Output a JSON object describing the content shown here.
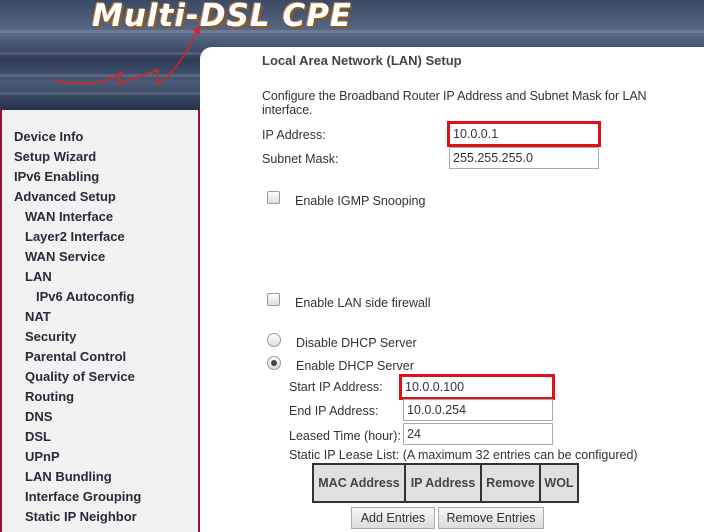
{
  "banner": {
    "logo_text": "Multi-DSL CPE"
  },
  "sidebar": {
    "items": [
      {
        "label": "Device Info",
        "level": 0
      },
      {
        "label": "Setup Wizard",
        "level": 0
      },
      {
        "label": "IPv6 Enabling",
        "level": 0
      },
      {
        "label": "Advanced Setup",
        "level": 0
      },
      {
        "label": "WAN Interface",
        "level": 1
      },
      {
        "label": "Layer2 Interface",
        "level": 1
      },
      {
        "label": "WAN Service",
        "level": 1
      },
      {
        "label": "LAN",
        "level": 1
      },
      {
        "label": "IPv6 Autoconfig",
        "level": 2
      },
      {
        "label": "NAT",
        "level": 1
      },
      {
        "label": "Security",
        "level": 1
      },
      {
        "label": "Parental Control",
        "level": 1
      },
      {
        "label": "Quality of Service",
        "level": 1
      },
      {
        "label": "Routing",
        "level": 1
      },
      {
        "label": "DNS",
        "level": 1
      },
      {
        "label": "DSL",
        "level": 1
      },
      {
        "label": "UPnP",
        "level": 1
      },
      {
        "label": "LAN Bundling",
        "level": 1
      },
      {
        "label": "Interface Grouping",
        "level": 1
      },
      {
        "label": "Static IP Neighbor",
        "level": 1
      }
    ]
  },
  "main": {
    "title": "Local Area Network (LAN) Setup",
    "description": "Configure the Broadband Router IP Address and Subnet Mask for LAN interface.",
    "ip_label": "IP Address:",
    "ip_value": "10.0.0.1",
    "mask_label": "Subnet Mask:",
    "mask_value": "255.255.255.0",
    "igmp_label": "Enable IGMP Snooping",
    "igmp_checked": false,
    "firewall_label": "Enable LAN side firewall",
    "firewall_checked": false,
    "disable_dhcp_label": "Disable DHCP Server",
    "enable_dhcp_label": "Enable DHCP Server",
    "dhcp_selected": "enable",
    "start_ip_label": "Start IP Address:",
    "start_ip_value": "10.0.0.100",
    "end_ip_label": "End IP Address:",
    "end_ip_value": "10.0.0.254",
    "lease_label": "Leased Time (hour):",
    "lease_value": "24",
    "static_lease_label": "Static IP Lease List: (A maximum 32 entries can be configured)",
    "table_headers": [
      "MAC Address",
      "IP Address",
      "Remove",
      "WOL"
    ],
    "add_button": "Add Entries",
    "remove_button": "Remove Entries",
    "highlight_color": "#e0101a"
  }
}
